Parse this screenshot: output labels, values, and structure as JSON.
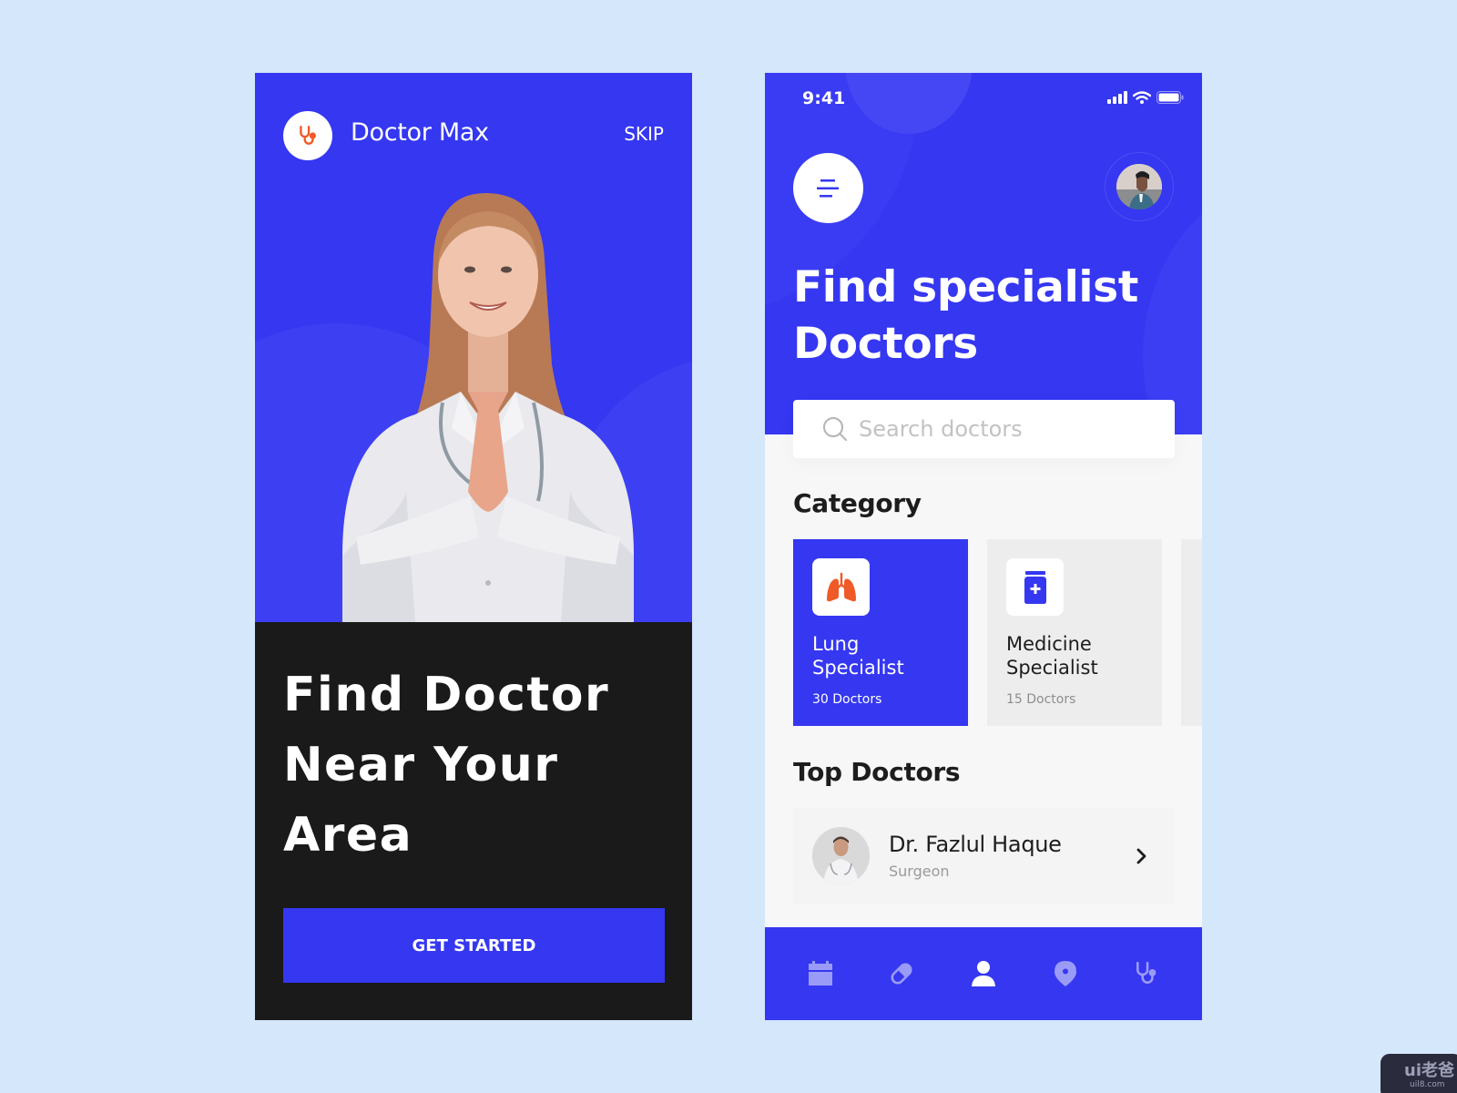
{
  "onboarding": {
    "brand_name": "Doctor Max",
    "skip_label": "SKIP",
    "headline_lines": [
      "Find Doctor",
      "Near Your",
      "Area"
    ],
    "cta_label": "GET STARTED",
    "logo_icon": "stethoscope-icon"
  },
  "home": {
    "status_bar": {
      "time": "9:41",
      "icons": [
        "signal-icon",
        "wifi-icon",
        "battery-icon"
      ]
    },
    "menu_icon": "menu-icon",
    "title_lines": [
      "Find specialist",
      "Doctors"
    ],
    "search": {
      "placeholder": "Search doctors",
      "value": ""
    },
    "category": {
      "title": "Category",
      "items": [
        {
          "name_lines": [
            "Lung",
            "Specialist"
          ],
          "count": "30 Doctors",
          "icon": "lungs-icon",
          "active": true
        },
        {
          "name_lines": [
            "Medicine",
            "Specialist"
          ],
          "count": "15 Doctors",
          "icon": "medicine-bottle-icon",
          "active": false
        }
      ]
    },
    "top_doctors": {
      "title": "Top Doctors",
      "items": [
        {
          "name": "Dr. Fazlul Haque",
          "specialty": "Surgeon"
        }
      ]
    },
    "bottom_nav": {
      "items": [
        {
          "icon": "calendar-icon",
          "active": false
        },
        {
          "icon": "pill-icon",
          "active": false
        },
        {
          "icon": "user-icon",
          "active": true
        },
        {
          "icon": "location-pin-icon",
          "active": false
        },
        {
          "icon": "stethoscope-icon",
          "active": false
        }
      ]
    }
  },
  "colors": {
    "primary": "#3537f1",
    "accent_orange": "#f05a28",
    "dark_bg": "#1a1a1a",
    "page_bg": "#d4e7fb"
  },
  "watermark": {
    "top": "ui老爸",
    "bottom": "uil8.com"
  }
}
